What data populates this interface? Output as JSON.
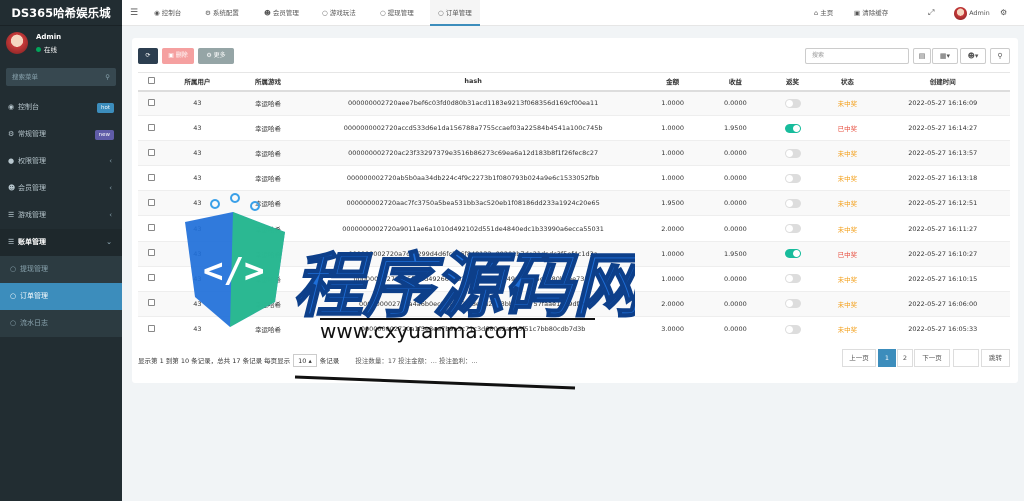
{
  "brand": "DS365哈希娱乐城",
  "user": {
    "name": "Admin",
    "status": "在线"
  },
  "sidebar_search_placeholder": "搜索菜单",
  "menu": [
    {
      "label": "控制台",
      "badge": "hot",
      "badge_color": "#3c8dbc"
    },
    {
      "label": "常规管理",
      "badge": "new",
      "badge_color": "#605ca8"
    },
    {
      "label": "权限管理"
    },
    {
      "label": "会员管理"
    },
    {
      "label": "游戏管理"
    },
    {
      "label": "账单管理",
      "open": true
    }
  ],
  "submenu": [
    "提现管理",
    "订单管理",
    "流水日志"
  ],
  "topbar": {
    "tabs": [
      "控制台",
      "系统配置",
      "会员管理",
      "游戏玩法",
      "提现管理",
      "订单管理"
    ],
    "home": "主页",
    "clear_cache": "清除缓存",
    "admin": "Admin"
  },
  "toolbar": {
    "refresh_icon": "refresh-icon",
    "delete": "删除",
    "more": "更多",
    "search_placeholder": "搜索"
  },
  "table": {
    "headers": [
      "所属用户",
      "所属游戏",
      "hash",
      "金额",
      "收益",
      "返奖",
      "状态",
      "创建时间"
    ],
    "rows": [
      {
        "user": "43",
        "game": "幸运哈希",
        "hash": "000000002720aee7bef6c03fd0d80b31acd1183e9213f068356d169cf00ea11",
        "amount": "1.0000",
        "profit": "0.0000",
        "reward": false,
        "status": "未中奖",
        "time": "2022-05-27 16:16:09"
      },
      {
        "user": "43",
        "game": "幸运哈希",
        "hash": "0000000002720accd533d6e1da156788a7755ccaef03a22584b4541a100c745b",
        "amount": "1.0000",
        "profit": "1.9500",
        "reward": true,
        "status": "已中奖",
        "time": "2022-05-27 16:14:27"
      },
      {
        "user": "43",
        "game": "幸运哈希",
        "hash": "000000002720ac23f33297379e3516b86273c69ea6a12d183b8f1f26fec8c27",
        "amount": "1.0000",
        "profit": "0.0000",
        "reward": false,
        "status": "未中奖",
        "time": "2022-05-27 16:13:57"
      },
      {
        "user": "43",
        "game": "幸运哈希",
        "hash": "000000002720ab5b0aa34db224c4f9c2273b1f080793b024a9e6c1533052fbb",
        "amount": "1.0000",
        "profit": "0.0000",
        "reward": false,
        "status": "未中奖",
        "time": "2022-05-27 16:13:18"
      },
      {
        "user": "43",
        "game": "幸运哈希",
        "hash": "000000002720aac7fc3750a5bea531bb3ac520eb1f08186dd233a1924c20e65",
        "amount": "1.9500",
        "profit": "0.0000",
        "reward": false,
        "status": "未中奖",
        "time": "2022-05-27 16:12:51"
      },
      {
        "user": "43",
        "game": "幸运哈希",
        "hash": "0000000002720a9011ae6a1010d492102d551de4840edc1b33990a6ecca55031",
        "amount": "2.0000",
        "profit": "0.0000",
        "reward": false,
        "status": "未中奖",
        "time": "2022-05-27 16:11:27"
      },
      {
        "user": "43",
        "game": "幸运哈希",
        "hash": "000000002720a7cac299d4d6fc296f848133a09201b7de21dadc3f5ef4c1d3a",
        "amount": "1.0000",
        "profit": "1.9500",
        "reward": true,
        "status": "已中奖",
        "time": "2022-05-27 16:10:27"
      },
      {
        "user": "43",
        "game": "幸运哈希",
        "hash": "000000002720a5f7f2d49266d8b2b678dd955b4999b575cb280b6ee7339",
        "amount": "1.0000",
        "profit": "0.0000",
        "reward": false,
        "status": "未中奖",
        "time": "2022-05-27 16:10:15"
      },
      {
        "user": "43",
        "game": "幸运哈希",
        "hash": "000000002720a4a6b0ec23e4b2f08e4d2b73bbe246757faae1a09df19",
        "amount": "2.0000",
        "profit": "0.0000",
        "reward": false,
        "status": "未中奖",
        "time": "2022-05-27 16:06:00"
      },
      {
        "user": "43",
        "game": "幸运哈希",
        "hash": "000000002720a1f5e8ea7b9a3c71c3d680e2ab45f51c7bb80cdb7d3b",
        "amount": "3.0000",
        "profit": "0.0000",
        "reward": false,
        "status": "未中奖",
        "time": "2022-05-27 16:05:33"
      }
    ]
  },
  "colors": {
    "lost": "#f39c12",
    "won": "#e74c3c",
    "primary": "#3c8dbc",
    "toggle_on": "#18bc9c"
  },
  "pager": {
    "info_pre": "显示第 1 到第 10 条记录，总共 17 条记录 每页显示",
    "page_size": "10",
    "info_post": "条记录",
    "stats": "投注数量：17    投注金额：...    投注盈利：...",
    "prev": "上一页",
    "pages": [
      "1",
      "2"
    ],
    "next": "下一页",
    "jump": "跳转"
  },
  "watermark": {
    "text": "程序源码网",
    "url": "www.cxyuanma.com"
  }
}
